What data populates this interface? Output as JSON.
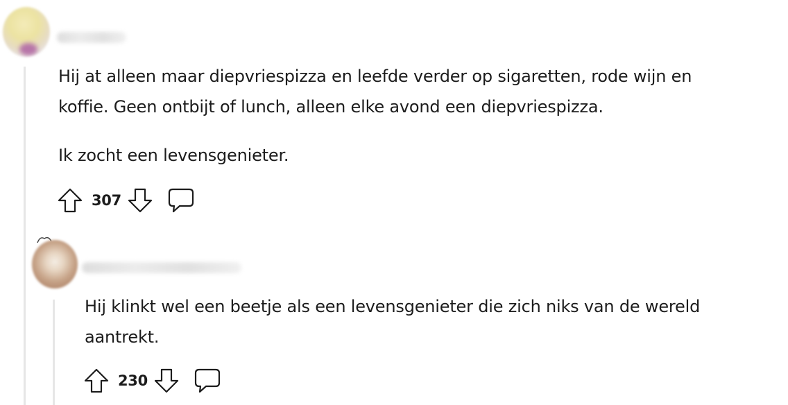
{
  "comments": [
    {
      "username": "",
      "paragraphs": [
        "Hij at alleen maar diepvriespizza en leefde verder op sigaretten, rode wijn en",
        "koffie. Geen ontbijt of lunch, alleen elke avond een diepvriespizza.",
        "Ik zocht een levensgenieter."
      ],
      "score": "307",
      "icons": {
        "upvote": "upvote-arrow-icon",
        "downvote": "downvote-arrow-icon",
        "reply": "speech-bubble-icon"
      }
    },
    {
      "username": "",
      "paragraphs": [
        "Hij klinkt wel een beetje als een levensgenieter die zich niks van de wereld",
        "aantrekt."
      ],
      "score": "230",
      "icons": {
        "upvote": "upvote-arrow-icon",
        "downvote": "downvote-arrow-icon",
        "reply": "speech-bubble-icon"
      }
    }
  ],
  "colors": {
    "text": "#1c1c1c",
    "thread_line": "#e6e6e6",
    "icon_stroke": "#1c1c1c"
  }
}
